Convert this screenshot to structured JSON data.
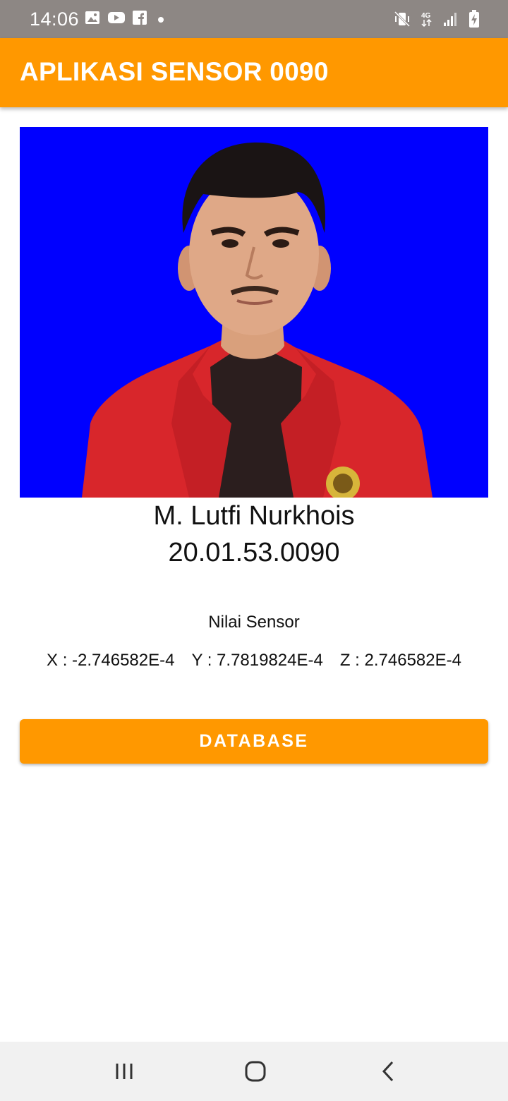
{
  "status_bar": {
    "time": "14:06",
    "left_icons": [
      "gallery-icon",
      "youtube-icon",
      "facebook-icon",
      "notification-dot-icon"
    ],
    "right_icons": [
      "vibrate-mute-icon",
      "4g-icon",
      "signal-icon",
      "battery-charging-icon"
    ],
    "network_label": "4G"
  },
  "app_bar": {
    "title": "APLIKASI SENSOR 0090",
    "color": "#ff9800"
  },
  "profile": {
    "photo_background": "#0000ff",
    "name": "M. Lutfi Nurkhois",
    "nim": "20.01.53.0090"
  },
  "sensor": {
    "title": "Nilai Sensor",
    "x": "X : -2.746582E-4",
    "y": "Y : 7.7819824E-4",
    "z": "Z : 2.746582E-4"
  },
  "actions": {
    "database_label": "DATABASE"
  },
  "nav_bar": {
    "items": [
      "recent-apps-icon",
      "home-icon",
      "back-icon"
    ]
  }
}
